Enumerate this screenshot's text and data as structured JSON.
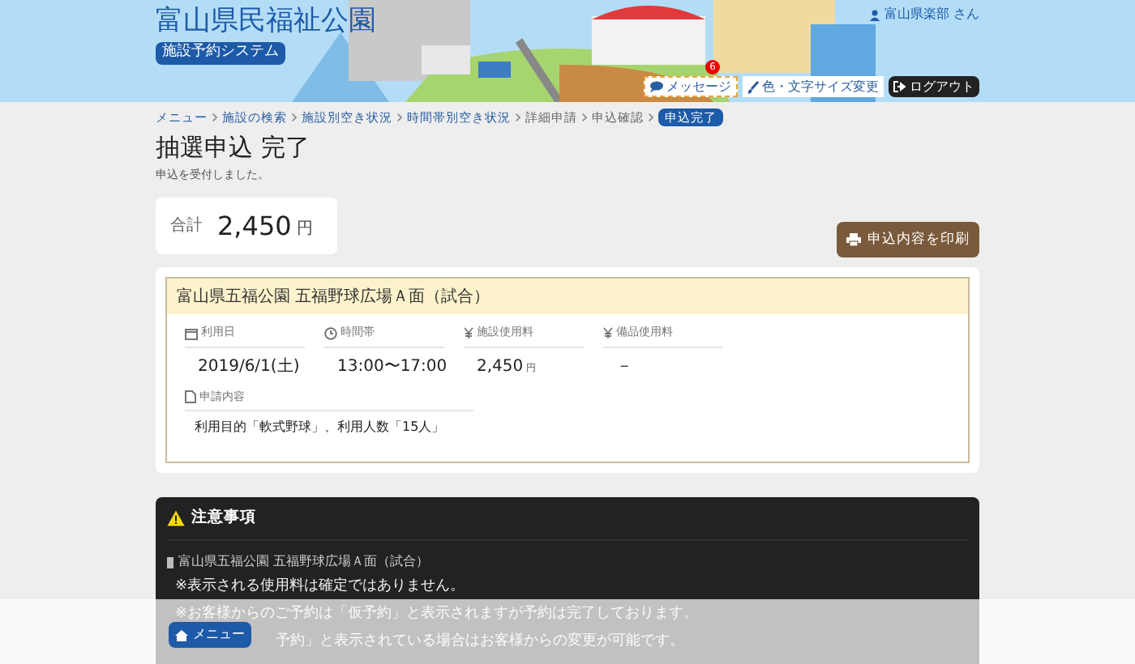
{
  "header": {
    "site_title": "富山県民福祉公園",
    "system_label": "施設予約システム",
    "user": "富山県楽部 さん",
    "message_button": "メッセージ",
    "message_count": "6",
    "display_button": "色・文字サイズ変更",
    "logout_button": "ログアウト"
  },
  "breadcrumb": [
    {
      "label": "メニュー",
      "kind": "link"
    },
    {
      "label": "施設の検索",
      "kind": "link"
    },
    {
      "label": "施設別空き状況",
      "kind": "link"
    },
    {
      "label": "時間帯別空き状況",
      "kind": "link"
    },
    {
      "label": "詳細申請",
      "kind": "text"
    },
    {
      "label": "申込確認",
      "kind": "text"
    },
    {
      "label": "申込完了",
      "kind": "current"
    }
  ],
  "page": {
    "title": "抽選申込 完了",
    "subtitle": "申込を受付しました。"
  },
  "total": {
    "label": "合計",
    "amount": "2,450",
    "unit": "円"
  },
  "print_button": "申込内容を印刷",
  "reservation": {
    "facility": "富山県五福公園 五福野球広場Ａ面（試合）",
    "fields": [
      {
        "label": "利用日",
        "kind": "date",
        "value": "2019/6/1(土)"
      },
      {
        "label": "時間帯",
        "kind": "time",
        "value": "13:00〜17:00"
      },
      {
        "label": "施設使用料",
        "kind": "fee",
        "value": "2,450",
        "unit": "円"
      },
      {
        "label": "備品使用料",
        "kind": "fee",
        "value": "－"
      }
    ],
    "details_label": "申請内容",
    "details": "利用目的「軟式野球」、利用人数「15人」"
  },
  "notes": {
    "title": "注意事項",
    "facility": "富山県五福公園 五福野球広場Ａ面（試合）",
    "lines": [
      "※表示される使用料は確定ではありません。",
      "※お客様からのご予約は「仮予約」と表示されますが予約は完了しております。",
      "予約」と表示されている場合はお客様からの変更が可能です。"
    ]
  },
  "footer": {
    "menu_button": "メニュー"
  }
}
